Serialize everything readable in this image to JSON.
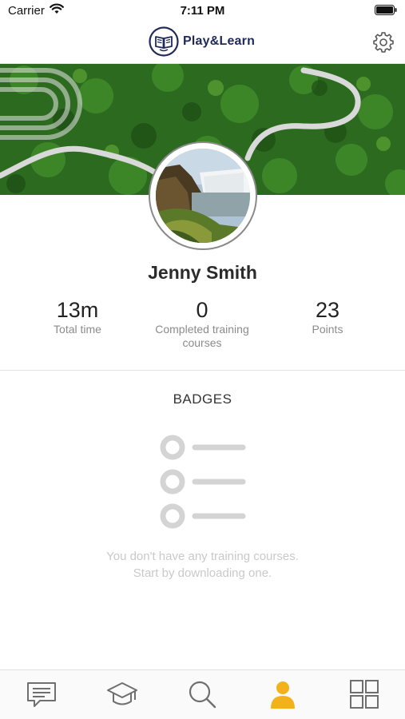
{
  "status_bar": {
    "carrier": "Carrier",
    "time": "7:11 PM"
  },
  "header": {
    "app_name": "Play&Learn"
  },
  "profile": {
    "name": "Jenny Smith",
    "stats": [
      {
        "value": "13m",
        "label": "Total time"
      },
      {
        "value": "0",
        "label": "Completed training courses"
      },
      {
        "value": "23",
        "label": "Points"
      }
    ]
  },
  "badges": {
    "title": "BADGES",
    "empty_line1": "You don't have any training courses.",
    "empty_line2": "Start by downloading one."
  },
  "tabs": [
    {
      "icon": "message-icon",
      "active": false
    },
    {
      "icon": "graduation-cap-icon",
      "active": false
    },
    {
      "icon": "search-icon",
      "active": false
    },
    {
      "icon": "person-icon",
      "active": true
    },
    {
      "icon": "grid-icon",
      "active": false
    }
  ],
  "colors": {
    "brand_navy": "#1f2a5a",
    "accent_active": "#f3b21b",
    "tab_inactive": "#6f6f6f",
    "empty_state": "#d4d4d4"
  }
}
